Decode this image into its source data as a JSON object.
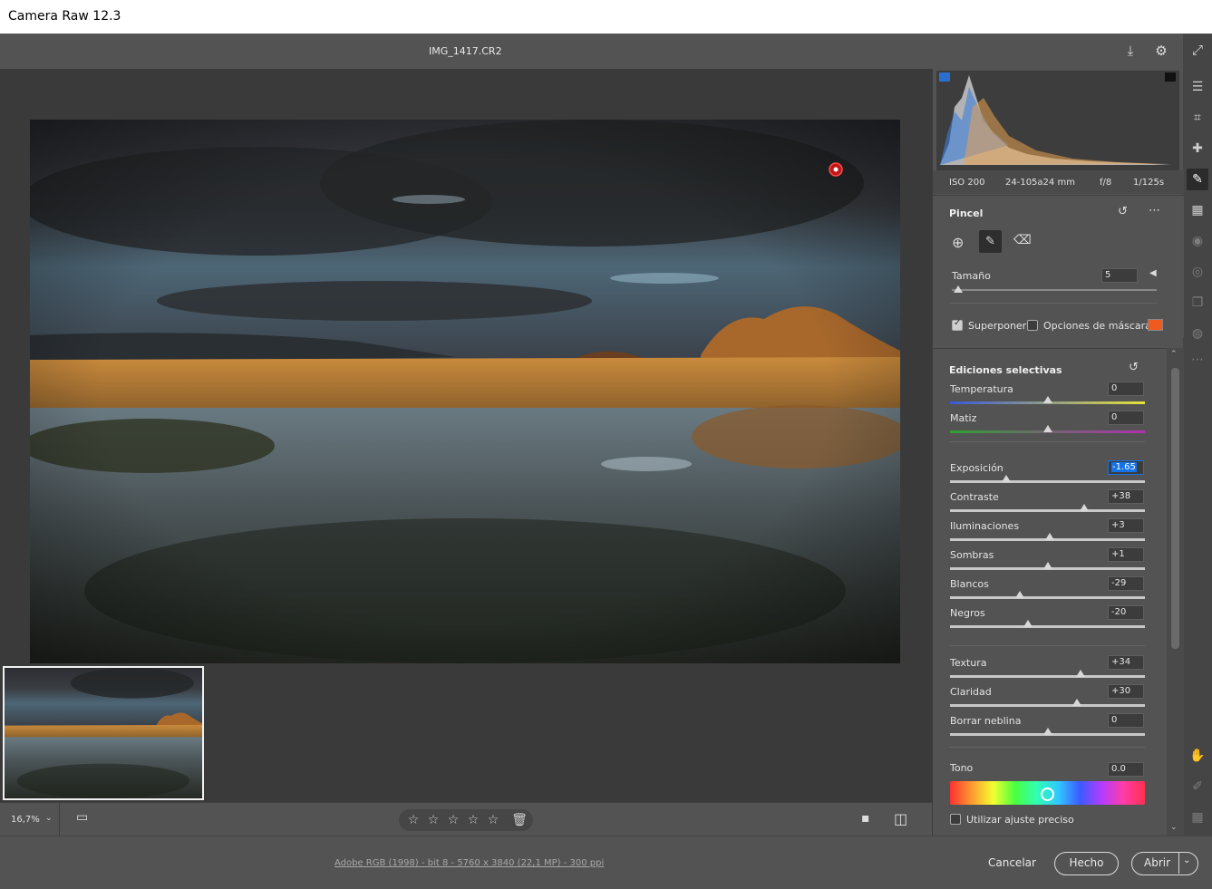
{
  "window": {
    "title": "Camera Raw 12.3"
  },
  "header": {
    "filename": "IMG_1417.CR2"
  },
  "histogram_info": {
    "iso": "ISO 200",
    "lens": "24-105a24 mm",
    "aperture": "f/8",
    "shutter": "1/125s"
  },
  "brush": {
    "title": "Pincel",
    "size_label": "Tamaño",
    "size_value": "5",
    "size_fraction": 0.03,
    "overlay_label": "Superponer",
    "overlay_checked": true,
    "mask_options_label": "Opciones de máscara",
    "mask_options_checked": false,
    "mask_color": "#f05a1e"
  },
  "selective": {
    "title": "Ediciones selectivas",
    "sliders": [
      {
        "key": "temperatura",
        "label": "Temperatura",
        "value": "0",
        "fraction": 0.5
      },
      {
        "key": "matiz",
        "label": "Matiz",
        "value": "0",
        "fraction": 0.5
      },
      {
        "key": "exposicion",
        "label": "Exposición",
        "value": "-1.65",
        "fraction": 0.29,
        "highlight": true
      },
      {
        "key": "contraste",
        "label": "Contraste",
        "value": "+38",
        "fraction": 0.69
      },
      {
        "key": "iluminaciones",
        "label": "Iluminaciones",
        "value": "+3",
        "fraction": 0.51
      },
      {
        "key": "sombras",
        "label": "Sombras",
        "value": "+1",
        "fraction": 0.5
      },
      {
        "key": "blancos",
        "label": "Blancos",
        "value": "-29",
        "fraction": 0.36
      },
      {
        "key": "negros",
        "label": "Negros",
        "value": "-20",
        "fraction": 0.4
      },
      {
        "key": "textura",
        "label": "Textura",
        "value": "+34",
        "fraction": 0.67
      },
      {
        "key": "claridad",
        "label": "Claridad",
        "value": "+30",
        "fraction": 0.65
      },
      {
        "key": "borrar-neblina",
        "label": "Borrar neblina",
        "value": "0",
        "fraction": 0.5
      }
    ],
    "tone_label": "Tono",
    "tone_value": "0.0",
    "tone_fraction": 0.5,
    "fine_label": "Utilizar ajuste preciso",
    "fine_checked": false
  },
  "bottom": {
    "zoom": "16,7%"
  },
  "status": {
    "file_info": "Adobe RGB (1998) - bit 8 - 5760 x 3840 (22,1 MP) - 300 ppi"
  },
  "actions": {
    "cancel": "Cancelar",
    "done": "Hecho",
    "open": "Abrir"
  },
  "colors": {
    "accent": "#1473e6",
    "panel_bg": "#535353",
    "canvas_bg": "#3a3a3a"
  }
}
